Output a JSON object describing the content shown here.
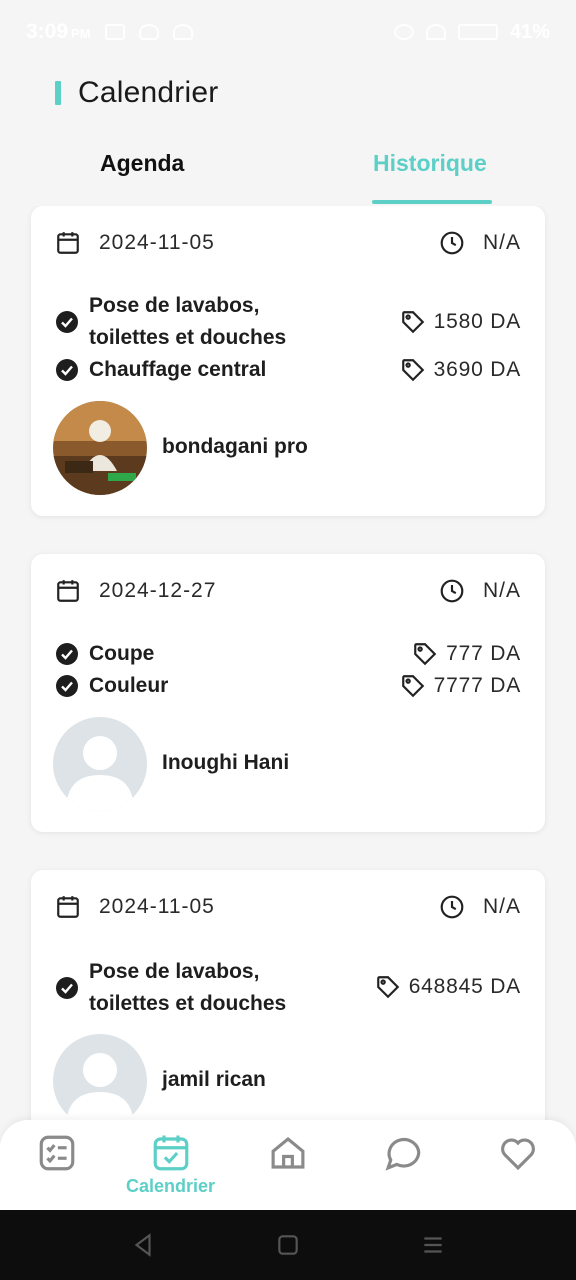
{
  "status_bar": {
    "time": "3:09",
    "ampm": "PM",
    "battery": "41%"
  },
  "header": {
    "title": "Calendrier"
  },
  "tabs": {
    "agenda": "Agenda",
    "history": "Historique"
  },
  "appointments": [
    {
      "date": "2024-11-05",
      "time": "N/A",
      "services": [
        {
          "line1": "Pose de lavabos,",
          "line2": "toilettes et douches",
          "price": "1580 DA"
        },
        {
          "line1": "Chauffage central",
          "line2": "",
          "price": "3690 DA"
        }
      ],
      "provider": "bondagani pro"
    },
    {
      "date": "2024-12-27",
      "time": "N/A",
      "services": [
        {
          "line1": "Coupe",
          "line2": "",
          "price": "777 DA"
        },
        {
          "line1": "Couleur",
          "line2": "",
          "price": "7777 DA"
        }
      ],
      "provider": "Inoughi Hani"
    },
    {
      "date": "2024-11-05",
      "time": "N/A",
      "services": [
        {
          "line1": "Pose de lavabos,",
          "line2": "toilettes et douches",
          "price": "648845 DA"
        }
      ],
      "provider": "jamil rican"
    }
  ],
  "bottom_nav": {
    "active_label": "Calendrier",
    "items": [
      "checklist-icon",
      "calendar-check-icon",
      "home-icon",
      "chat-icon",
      "heart-icon"
    ]
  },
  "colors": {
    "accent": "#5ccfc7",
    "text": "#1c1c1c",
    "background": "#f5f5f5"
  }
}
